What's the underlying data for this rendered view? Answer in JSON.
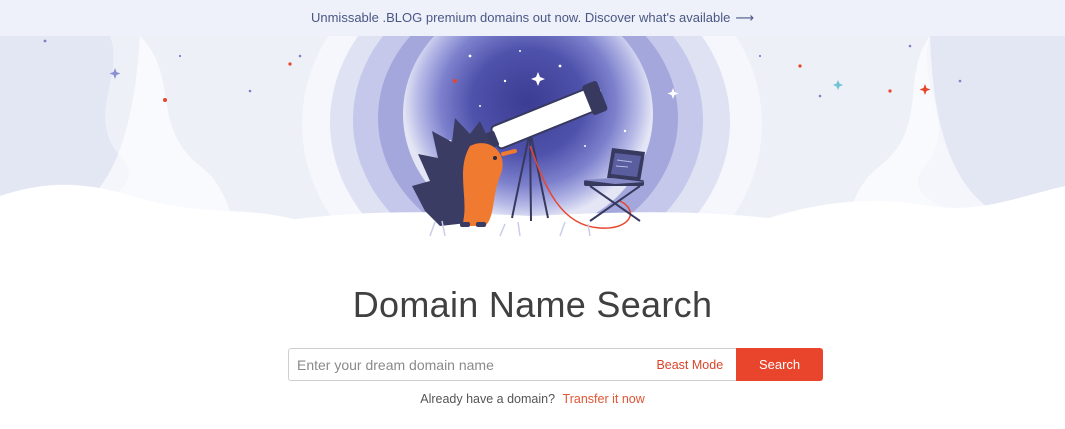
{
  "promo": {
    "text": "Unmissable .BLOG premium domains out now. Discover what's available",
    "arrow": "⟶"
  },
  "hero": {
    "illustration": "hedgehog-with-telescope-and-laptop",
    "colors": {
      "sky_deep": "#3d3f96",
      "sky_mid": "#6b6fc2",
      "mist": "#e7eaf6",
      "accent": "#e8452c"
    }
  },
  "main": {
    "title": "Domain Name Search",
    "search": {
      "placeholder": "Enter your dream domain name",
      "value": "",
      "beast_mode_label": "Beast Mode",
      "button_label": "Search"
    },
    "transfer": {
      "prompt": "Already have a domain?",
      "link_label": "Transfer it now"
    }
  },
  "colors": {
    "accent": "#e8452c",
    "promo_bg": "#eef1f9",
    "promo_text": "#4a5785",
    "title": "#404040"
  }
}
